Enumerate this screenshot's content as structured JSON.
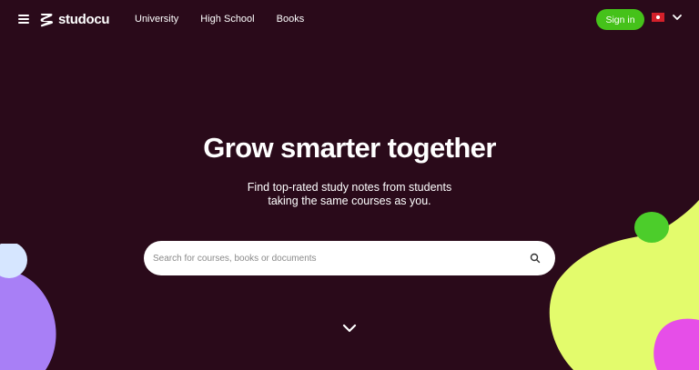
{
  "header": {
    "logo_text": "studocu",
    "nav": [
      {
        "label": "University"
      },
      {
        "label": "High School"
      },
      {
        "label": "Books"
      }
    ],
    "signin_label": "Sign in",
    "language_flag": "hong-kong-flag-icon"
  },
  "hero": {
    "title": "Grow smarter together",
    "subtitle_line1": "Find top-rated study notes from students",
    "subtitle_line2": "taking the same courses as you.",
    "search_placeholder": "Search for courses, books or documents",
    "search_value": ""
  },
  "colors": {
    "background": "#2a0a1a",
    "accent_green": "#45c21a",
    "blob_lime": "#e3fb6c",
    "blob_lavender": "#a87ff6",
    "blob_lightblue": "#d6e6ff",
    "blob_green": "#4ccd2b",
    "blob_magenta": "#e64ee8"
  }
}
